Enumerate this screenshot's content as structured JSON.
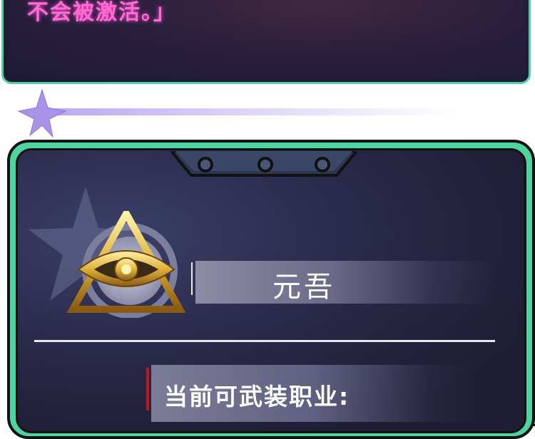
{
  "top_panel": {
    "text": "不会被激活。」"
  },
  "profile": {
    "name": "元吾",
    "class_label": "当前可武装职业:"
  },
  "colors": {
    "frame_green": "#4dd4a0",
    "top_text_pink": "#ff6ad5",
    "accent_red": "#c4141a",
    "divider_lavender": "#b9a6ef",
    "emblem_gold": "#e0b43a"
  },
  "icons": {
    "emblem": "golden-triangle-eye-emblem-icon",
    "divider_star": "star-icon",
    "background_star": "star-icon"
  }
}
